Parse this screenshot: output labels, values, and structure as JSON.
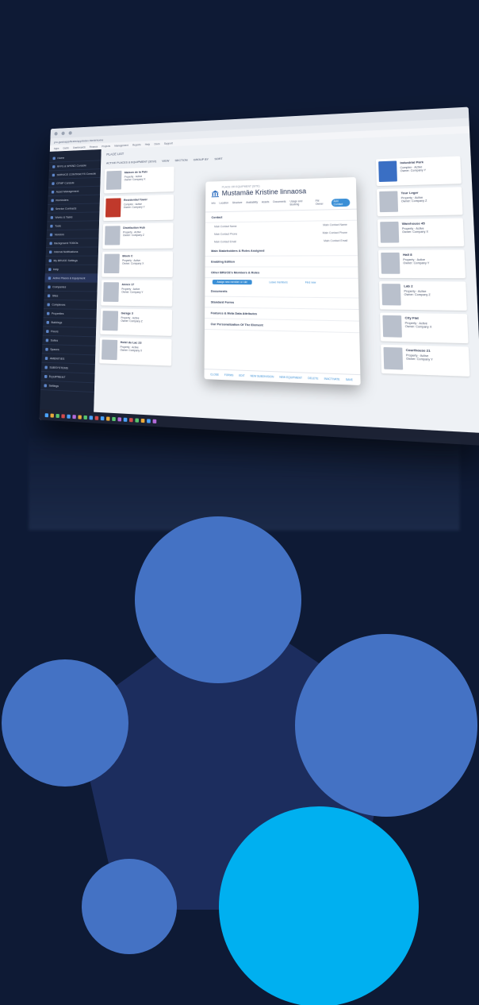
{
  "browser": {
    "address": "pro.gustoapp/fleete/app/index.html#/home",
    "bookmarks": [
      "Apps",
      "Gusto",
      "Dashboards",
      "Finance",
      "Projects",
      "Management",
      "Reports",
      "Help",
      "Docs",
      "Support"
    ]
  },
  "app": {
    "header_title": "PLACE LIST",
    "filters": [
      "ACTIVE PLACES & EQUIPMENT (3212)",
      "VIEW",
      "SECTION",
      "GROUP BY",
      "SORT"
    ]
  },
  "sidebar": {
    "items": [
      {
        "label": "Home"
      },
      {
        "label": "RFPs & SPEND Console"
      },
      {
        "label": "SERVICE CONTRACTS Console"
      },
      {
        "label": "CFMP Console"
      },
      {
        "label": "Asset Management"
      },
      {
        "label": "Reminders"
      },
      {
        "label": "Service Contracts"
      },
      {
        "label": "Works & Tasks"
      },
      {
        "label": "Tools"
      },
      {
        "label": "Vendors"
      },
      {
        "label": "Background TODOs"
      },
      {
        "label": "Internal Notifications"
      },
      {
        "label": "My BRUCE Settings"
      },
      {
        "label": "Help"
      },
      {
        "label": "Active Places & Equipment"
      },
      {
        "label": "Companies"
      },
      {
        "label": "Sites"
      },
      {
        "label": "Complexes"
      },
      {
        "label": "Properties"
      },
      {
        "label": "Buildings"
      },
      {
        "label": "Floors"
      },
      {
        "label": "Suites"
      },
      {
        "label": "Spaces"
      },
      {
        "label": "AMENITIES"
      },
      {
        "label": "SUBSYSTEMS"
      },
      {
        "label": "EQUIPMENT"
      },
      {
        "label": "Settings"
      }
    ]
  },
  "cards": [
    {
      "title": "Maison de la Paix",
      "meta": "Property · Active",
      "owner": "Owner: Company X"
    },
    {
      "title": "Residential Tower",
      "meta": "Complex · Active",
      "owner": "Owner: Company Y"
    },
    {
      "title": "Distribution Hub",
      "meta": "Property · Active",
      "owner": "Owner: Company Z"
    },
    {
      "title": "Block C",
      "meta": "Property · Active",
      "owner": "Owner: Company X"
    },
    {
      "title": "Annex 17",
      "meta": "Property · Active",
      "owner": "Owner: Company Y"
    },
    {
      "title": "Garage 3",
      "meta": "Property · Active",
      "owner": "Owner: Company Z"
    },
    {
      "title": "Hotel du Lac 23",
      "meta": "Property · Active",
      "owner": "Owner: Company X"
    },
    {
      "title": "Industrial Park",
      "meta": "Complex · Active",
      "owner": "Owner: Company Y"
    },
    {
      "title": "Tour Leger",
      "meta": "Property · Active",
      "owner": "Owner: Company Z"
    },
    {
      "title": "Warehouse 45",
      "meta": "Property · Active",
      "owner": "Owner: Company X"
    },
    {
      "title": "Hall 8",
      "meta": "Property · Active",
      "owner": "Owner: Company Y"
    },
    {
      "title": "Lab 2",
      "meta": "Property · Active",
      "owner": "Owner: Company Z"
    },
    {
      "title": "City Flat",
      "meta": "Property · Active",
      "owner": "Owner: Company X"
    },
    {
      "title": "Courthouse 21",
      "meta": "Property · Active",
      "owner": "Owner: Company Y"
    }
  ],
  "modal": {
    "subtitle": "PLACE OR EQUIPMENT (SITE)",
    "title": "Mustamäe Kristine linnaosa",
    "tabs": [
      "Info",
      "Location",
      "Structure",
      "Availability",
      "Assets",
      "Documents",
      "Usage and Booking",
      "FM Owner",
      "Add Contact"
    ],
    "contact_header": "Contact",
    "contact_rows": [
      {
        "label": "Main Contact Name",
        "value": "Main Contact Name"
      },
      {
        "label": "Main Contact Phone",
        "value": "Main Contact Phone"
      },
      {
        "label": "Main Contact Email",
        "value": "Main Contact Email"
      }
    ],
    "sections": [
      "Main Stakeholders & Roles Assigned",
      "Enabling Edition",
      "Other BRUCE's Members & Roles"
    ],
    "assign_button": "Assign new member or role",
    "link_action_1": "Leave members",
    "link_action_2": "Find new",
    "sections_after": [
      "Documents",
      "Standard Forms",
      "Features & Meta Data Attributes",
      "Our Personalization Of The Element"
    ],
    "footer_actions": [
      "CLOSE",
      "FORMS",
      "EDIT",
      "NEW SUBDIVISION",
      "NEW EQUIPMENT",
      "DELETE",
      "INACTIVATE",
      "SAVE"
    ]
  },
  "colors": {
    "background": "#0e1a35",
    "pentagon": "#1c2d5e",
    "circle_blue": "#4472c4",
    "circle_cyan": "#00b0f0",
    "accent": "#3a8fd6"
  }
}
